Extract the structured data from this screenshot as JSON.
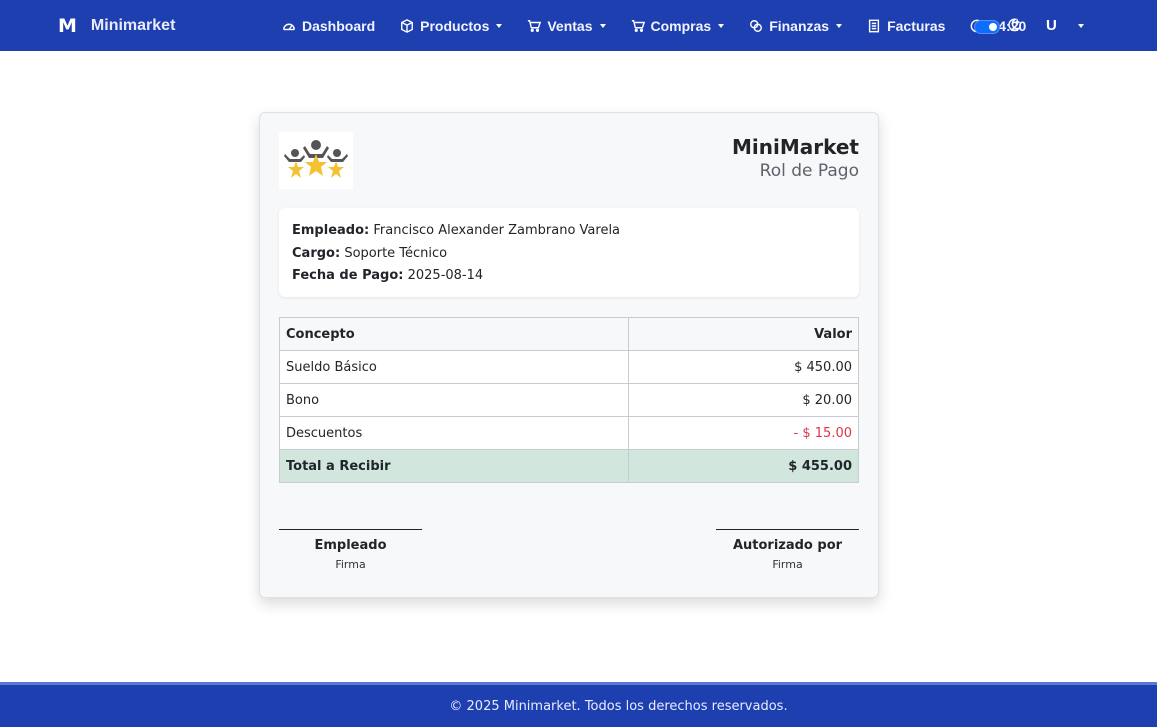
{
  "navbar": {
    "brand_logo": "M",
    "brand_name": "Minimarket",
    "items": [
      {
        "label": "Dashboard",
        "icon": "gauge-icon",
        "dropdown": false
      },
      {
        "label": "Productos",
        "icon": "box-icon",
        "dropdown": true
      },
      {
        "label": "Ventas",
        "icon": "cart-icon",
        "dropdown": true
      },
      {
        "label": "Compras",
        "icon": "cart-icon",
        "dropdown": true
      },
      {
        "label": "Finanzas",
        "icon": "cash-icon",
        "dropdown": true
      },
      {
        "label": "Facturas",
        "icon": "receipt-icon",
        "dropdown": false
      }
    ],
    "time": "14:20",
    "theme_toggle": {
      "on": true
    },
    "user_initial": "U"
  },
  "payslip": {
    "company": "MiniMarket",
    "document_title": "Rol de Pago",
    "employee_label": "Empleado:",
    "employee_value": "Francisco Alexander Zambrano Varela",
    "position_label": "Cargo:",
    "position_value": "Soporte Técnico",
    "date_label": "Fecha de Pago:",
    "date_value": "2025-08-14",
    "table": {
      "headers": [
        "Concepto",
        "Valor"
      ],
      "rows": [
        {
          "concept": "Sueldo Básico",
          "value": "$ 450.00"
        },
        {
          "concept": "Bono",
          "value": "$ 20.00"
        },
        {
          "concept": "Descuentos",
          "value": "- $ 15.00"
        }
      ],
      "total_label": "Total a Recibir",
      "total_value": "$ 455.00"
    },
    "signatures": [
      {
        "role": "Empleado",
        "caption": "Firma"
      },
      {
        "role": "Autorizado por",
        "caption": "Firma"
      }
    ]
  },
  "colors": {
    "navbar": "#1e3fb0",
    "total_row": "#d1e7dd",
    "negative": "#dc3545",
    "toggle": "#0d6efd"
  },
  "footer": {
    "text": "© 2025 Minimarket. Todos los derechos reservados."
  }
}
